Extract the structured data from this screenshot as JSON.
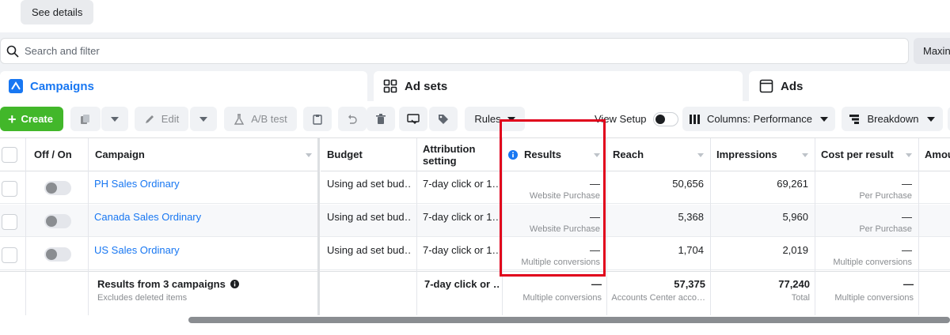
{
  "top": {
    "see_details": "See details"
  },
  "search": {
    "placeholder": "Search and filter",
    "right_button": "Maxin"
  },
  "tabs": [
    {
      "label": "Campaigns",
      "icon": "campaign-icon",
      "active": true
    },
    {
      "label": "Ad sets",
      "icon": "grid-icon"
    },
    {
      "label": "Ads",
      "icon": "ad-window-icon"
    }
  ],
  "toolbar": {
    "create": "Create",
    "edit": "Edit",
    "ab_test": "A/B test",
    "rules": "Rules",
    "view_setup": "View Setup",
    "columns": "Columns: Performance",
    "breakdown": "Breakdown"
  },
  "table": {
    "headers": {
      "off_on": "Off / On",
      "campaign": "Campaign",
      "budget": "Budget",
      "attribution": "Attribution setting",
      "results": "Results",
      "reach": "Reach",
      "impressions": "Impressions",
      "cost_per_result": "Cost per result",
      "amount": "Amou"
    },
    "rows": [
      {
        "campaign": "PH Sales Ordinary",
        "budget": "Using ad set bud…",
        "attribution": "7-day click or 1…",
        "results": "—",
        "results_sub": "Website Purchase",
        "reach": "50,656",
        "impressions": "69,261",
        "cost": "—",
        "cost_sub": "Per Purchase"
      },
      {
        "campaign": "Canada Sales Ordinary",
        "budget": "Using ad set bud…",
        "attribution": "7-day click or 1…",
        "results": "—",
        "results_sub": "Website Purchase",
        "reach": "5,368",
        "impressions": "5,960",
        "cost": "—",
        "cost_sub": "Per Purchase"
      },
      {
        "campaign": "US Sales Ordinary",
        "budget": "Using ad set bud…",
        "attribution": "7-day click or 1…",
        "results": "—",
        "results_sub": "Multiple conversions",
        "reach": "1,704",
        "impressions": "2,019",
        "cost": "—",
        "cost_sub": "Multiple conversions"
      }
    ],
    "summary": {
      "title": "Results from 3 campaigns",
      "subtitle": "Excludes deleted items",
      "attribution": "7-day click or …",
      "results": "—",
      "results_sub": "Multiple conversions",
      "reach": "57,375",
      "reach_sub": "Accounts Center acco…",
      "impressions": "77,240",
      "impressions_sub": "Total",
      "cost": "—",
      "cost_sub": "Multiple conversions"
    }
  },
  "colors": {
    "accent": "#1877f2",
    "create": "#42b72a",
    "highlight": "#e0001b"
  }
}
